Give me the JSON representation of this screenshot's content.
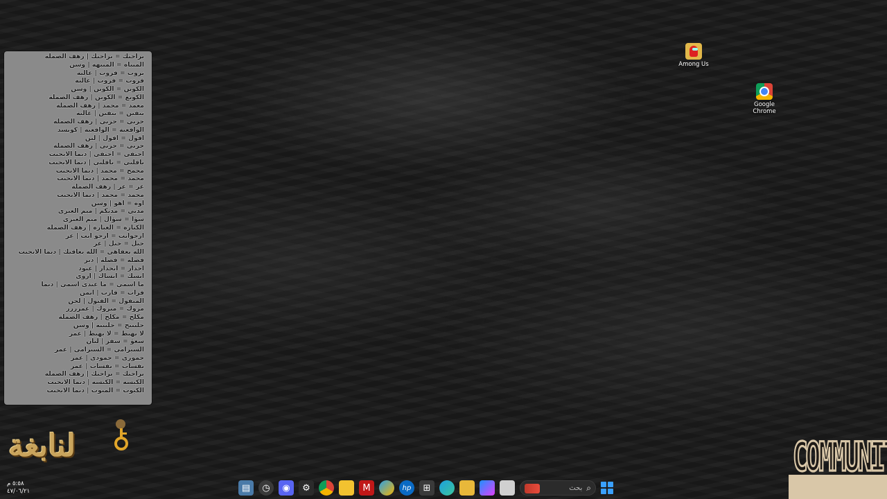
{
  "chat": {
    "lines": [
      "براحتك = براحتك | رهف الصملة",
      "المنباه = المنبهة | وسن",
      "تروب = قروب | غالية",
      "قروب = قروب | غالية",
      "الكوبن = الكوبن | وسن",
      "الكوبع = الكوبن | رهف الصملة",
      "معمد = محمد | رهف الصملة",
      "تيفين = تيفين | غالية",
      "حربي = حربي | رهف الصملة",
      "الواقعية = الواقعية | كونسد",
      "اقول = اقول | لين",
      "حربي = حربي | رهف الصملة",
      "احتفي = احتفي | ديما الايجنت",
      "يافلبي = يافلبي | ديما الايجنت",
      "محمج = محمد | ديما الايجنت",
      "محمد = محمد | ديما الايجنت",
      "عز = عز | رهف الصملة",
      "محمد = محمد | ديما الايجنت",
      "اوه = اهو | وسن",
      "مذتي = مذتكم | ميم العنزي",
      "سؤا = سؤال | ميم العنزي",
      "الكبارة = الغبارة | رهف الصملة",
      "ارجوانت = ارجو انت | عز",
      "حبل = حبل | عز",
      "الله يعفاهي = الله يعافيك | ديما الايجنت",
      "فصلة = فصلة | ذير",
      "اخدار = انحدار | عبود",
      "انسك = انساك | اروى",
      "ما اسمي = ما عندي اسمي | ديما",
      "قراب = قارب | ايمن",
      "المبقول = القبول | لجن",
      "مروك = مبروك | عمرررر",
      "مكلح = مكلح | رهف الصملة",
      "حلنبنج = حلنبنة | وسن",
      "لا يهبط = لا يهبط | عمر",
      "سغؤ = سفر | ليان",
      "السيرامي = السيرامي | عمر",
      "حموزي = حمودي | عمر",
      "يقساب = يقساب | عمر",
      "براحتك = براحتك | رهف الصملة",
      "الكيسه = الكيسه | ديما الايجنت",
      "الكيوت = الميوت | ديما الايجنت"
    ]
  },
  "desktop": {
    "icons": [
      {
        "name": "Among Us",
        "icon": "among-us-icon"
      },
      {
        "name": "Google\nChrome",
        "icon": "chrome-icon"
      }
    ]
  },
  "logo": {
    "text": "لنابغة"
  },
  "badge": {
    "text": "COMMUNITY"
  },
  "clock": {
    "time": "٥:٥٨ م",
    "date": "٤٧/٠٦/٢١"
  },
  "taskbar": {
    "search_placeholder": "بحث",
    "apps": [
      "app-window-icon",
      "clock-app-icon",
      "discord-icon",
      "settings-icon",
      "chrome-icon",
      "notes-icon",
      "mcafee-icon",
      "edge-alt-icon",
      "hp-icon",
      "store-icon",
      "edge-icon",
      "file-explorer-icon",
      "copilot-icon",
      "task-view-icon"
    ]
  },
  "colors": {
    "panel": "#8a8a8a",
    "logo": "#c9a45c",
    "start": "#3aa0ff"
  }
}
